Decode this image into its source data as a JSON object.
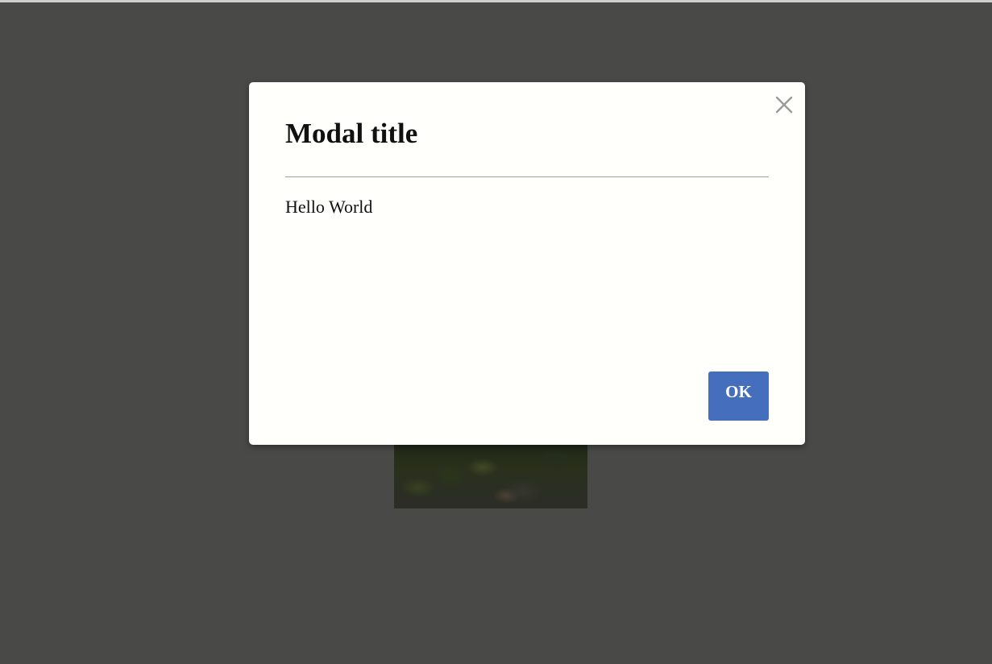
{
  "modal": {
    "title": "Modal title",
    "body_text": "Hello World",
    "ok_label": "OK",
    "close_icon": "close-icon"
  },
  "colors": {
    "page_background": "#545453",
    "modal_background": "#fffffb",
    "ok_button": "#456fbd",
    "close_icon": "#9a9a9a"
  }
}
